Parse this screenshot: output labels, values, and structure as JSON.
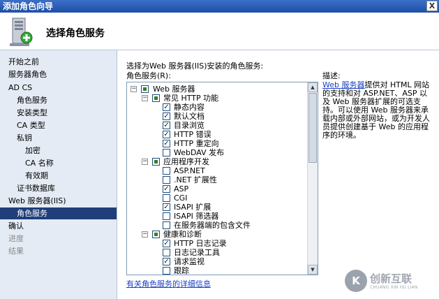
{
  "window": {
    "title": "添加角色向导",
    "close_label": "X"
  },
  "header": {
    "title": "选择角色服务"
  },
  "sidebar": {
    "items": [
      {
        "label": "开始之前"
      },
      {
        "label": "服务器角色"
      },
      {
        "label": "AD CS"
      },
      {
        "label": "角色服务"
      },
      {
        "label": "安装类型"
      },
      {
        "label": "CA 类型"
      },
      {
        "label": "私钥"
      },
      {
        "label": "加密"
      },
      {
        "label": "CA 名称"
      },
      {
        "label": "有效期"
      },
      {
        "label": "证书数据库"
      },
      {
        "label": "Web 服务器(IIS)"
      },
      {
        "label": "角色服务"
      },
      {
        "label": "确认"
      },
      {
        "label": "进度"
      },
      {
        "label": "结果"
      }
    ]
  },
  "main": {
    "intro": "选择为Web 服务器(IIS)安装的角色服务:",
    "list_label": "角色服务(R):",
    "tree": [
      {
        "label": "Web 服务器"
      },
      {
        "label": "常见 HTTP 功能"
      },
      {
        "label": "静态内容"
      },
      {
        "label": "默认文档"
      },
      {
        "label": "目录浏览"
      },
      {
        "label": "HTTP 错误"
      },
      {
        "label": "HTTP 重定向"
      },
      {
        "label": "WebDAV 发布"
      },
      {
        "label": "应用程序开发"
      },
      {
        "label": "ASP.NET"
      },
      {
        "label": ".NET 扩展性"
      },
      {
        "label": "ASP"
      },
      {
        "label": "CGI"
      },
      {
        "label": "ISAPI 扩展"
      },
      {
        "label": "ISAPI 筛选器"
      },
      {
        "label": "在服务器端的包含文件"
      },
      {
        "label": "健康和诊断"
      },
      {
        "label": "HTTP 日志记录"
      },
      {
        "label": "日志记录工具"
      },
      {
        "label": "请求监视"
      },
      {
        "label": "跟踪"
      }
    ],
    "more_link": "有关角色服务的详细信息"
  },
  "description": {
    "label": "描述:",
    "link": "Web 服务器",
    "text": "提供对 HTML 网站的支持和对 ASP.NET、ASP 以及 Web 服务器扩展的可选支持。可以使用 Web 服务器来承载内部或外部网站，或为开发人员提供创建基于 Web 的应用程序的环境。"
  },
  "watermark": {
    "logo": "K",
    "name": "创新互联",
    "sub": "CHUANG XIN HU LIAN"
  }
}
